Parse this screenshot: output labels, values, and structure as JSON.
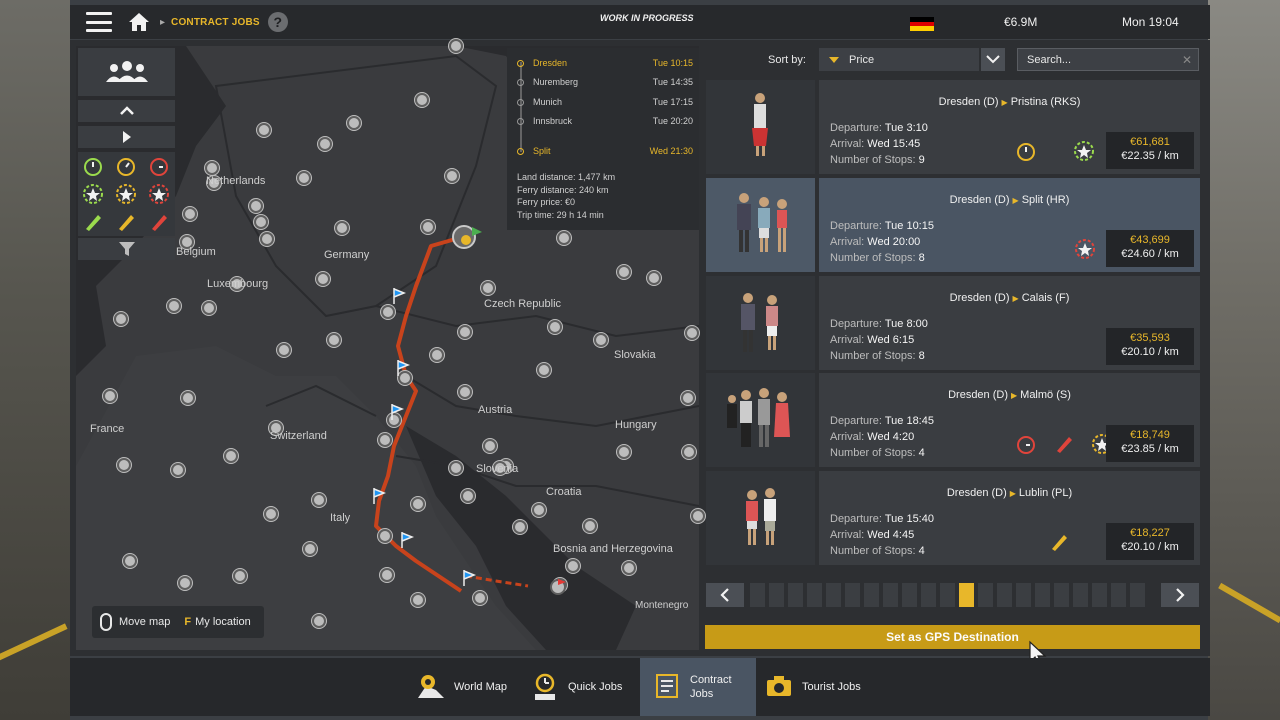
{
  "topbar": {
    "breadcrumb": "CONTRACT JOBS",
    "help_label": "?",
    "status": "WORK IN PROGRESS",
    "money": "€6.9M",
    "clock": "Mon 19:04",
    "flag_colors": [
      "#000000",
      "#dd0000",
      "#ffce00"
    ]
  },
  "map": {
    "labels": {
      "netherlands": "Netherlands",
      "belgium": "Belgium",
      "luxembourg": "Luxembourg",
      "germany": "Germany",
      "czech": "Czech Republic",
      "slovakia": "Slovakia",
      "france": "France",
      "switzerland": "Switzerland",
      "austria": "Austria",
      "hungary": "Hungary",
      "slovenia": "Slovenia",
      "croatia": "Croatia",
      "italy": "Italy",
      "bosnia": "Bosnia and Herzegovina",
      "montenegro": "Montenegro"
    },
    "route_color": "#c8431c",
    "hint_move": "Move map",
    "hint_key": "F",
    "hint_location": "My location"
  },
  "route_card": {
    "stops": [
      {
        "name": "Dresden",
        "time": "Tue 10:15",
        "highlight": true
      },
      {
        "name": "Nuremberg",
        "time": "Tue 14:35",
        "highlight": false
      },
      {
        "name": "Munich",
        "time": "Tue 17:15",
        "highlight": false
      },
      {
        "name": "Innsbruck",
        "time": "Tue 20:20",
        "highlight": false
      },
      {
        "name": "Split",
        "time": "Wed 21:30",
        "highlight": true
      }
    ],
    "land_distance": "Land distance: 1,477 km",
    "ferry_distance": "Ferry distance: 240 km",
    "ferry_price": "Ferry price: €0",
    "trip_time": "Trip time: 29 h 14 min"
  },
  "sort": {
    "label": "Sort by:",
    "value": "Price",
    "search_placeholder": "Search..."
  },
  "jobs": [
    {
      "route_from": "Dresden (D)",
      "route_to": "Pristina (RKS)",
      "dep_label": "Departure:",
      "departure": "Tue 3:10",
      "arr_label": "Arrival:",
      "arrival": "Wed 15:45",
      "stops_label": "Number of Stops:",
      "stops": "9",
      "price": "€61,681",
      "per_km": "€22.35 / km",
      "selected": false
    },
    {
      "route_from": "Dresden (D)",
      "route_to": "Split (HR)",
      "dep_label": "Departure:",
      "departure": "Tue 10:15",
      "arr_label": "Arrival:",
      "arrival": "Wed 20:00",
      "stops_label": "Number of Stops:",
      "stops": "8",
      "price": "€43,699",
      "per_km": "€24.60 / km",
      "selected": true
    },
    {
      "route_from": "Dresden (D)",
      "route_to": "Calais (F)",
      "dep_label": "Departure:",
      "departure": "Tue 8:00",
      "arr_label": "Arrival:",
      "arrival": "Wed 6:15",
      "stops_label": "Number of Stops:",
      "stops": "8",
      "price": "€35,593",
      "per_km": "€20.10 / km",
      "selected": false
    },
    {
      "route_from": "Dresden (D)",
      "route_to": "Malmö (S)",
      "dep_label": "Departure:",
      "departure": "Tue 18:45",
      "arr_label": "Arrival:",
      "arrival": "Wed 4:20",
      "stops_label": "Number of Stops:",
      "stops": "4",
      "price": "€18,749",
      "per_km": "€23.85 / km",
      "selected": false
    },
    {
      "route_from": "Dresden (D)",
      "route_to": "Lublin (PL)",
      "dep_label": "Departure:",
      "departure": "Tue 15:40",
      "arr_label": "Arrival:",
      "arrival": "Wed 4:45",
      "stops_label": "Number of Stops:",
      "stops": "4",
      "price": "€18,227",
      "per_km": "€20.10 / km",
      "selected": false
    }
  ],
  "pager": {
    "total_pages": 21,
    "current_page": 11
  },
  "gps_button": "Set as GPS Destination",
  "bottom_tabs": [
    {
      "label": "World Map",
      "icon": "map-pin-icon"
    },
    {
      "label": "Quick Jobs",
      "icon": "clock-icon"
    },
    {
      "label": "Contract Jobs",
      "icon": "contract-list-icon",
      "active": true
    },
    {
      "label": "Tourist Jobs",
      "icon": "camera-icon"
    }
  ],
  "colors": {
    "accent": "#e8b72a",
    "selected_row": "#4a5563",
    "panel": "#2d2f32"
  }
}
